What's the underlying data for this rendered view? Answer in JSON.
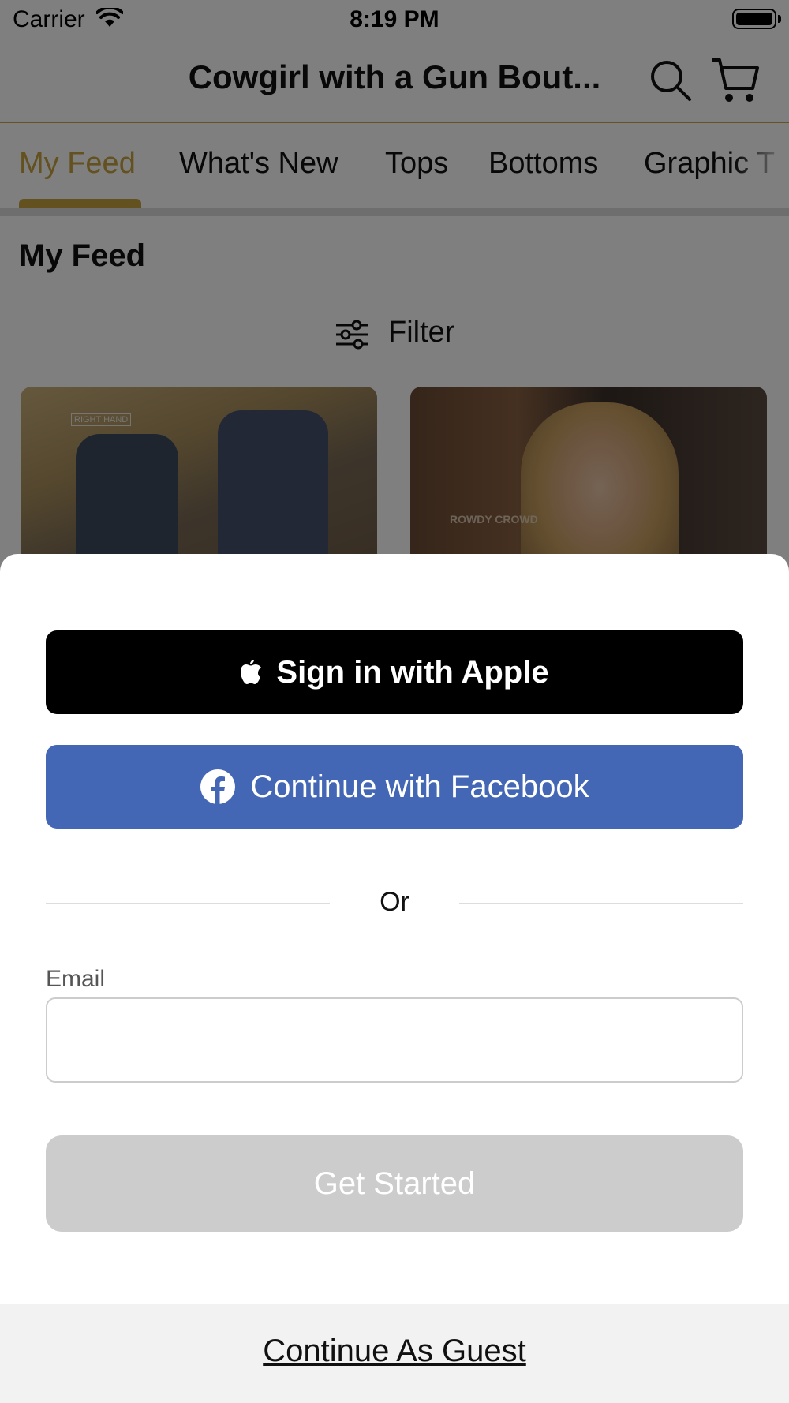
{
  "status_bar": {
    "carrier": "Carrier",
    "time": "8:19 PM"
  },
  "nav": {
    "title": "Cowgirl with a Gun Bout..."
  },
  "tabs": [
    {
      "label": "My Feed",
      "active": true
    },
    {
      "label": "What's New"
    },
    {
      "label": "Tops"
    },
    {
      "label": "Bottoms"
    },
    {
      "label": "Graphic T"
    }
  ],
  "feed": {
    "title": "My Feed",
    "filter_label": "Filter"
  },
  "products": [
    {
      "image_text": "RIGHT HAND"
    },
    {
      "image_text": "ROWDY CROWD"
    }
  ],
  "sheet": {
    "apple_label": "Sign in with Apple",
    "facebook_label": "Continue with Facebook",
    "or_text": "Or",
    "email_label": "Email",
    "email_value": "",
    "get_started_label": "Get Started",
    "guest_label": "Continue As Guest"
  },
  "colors": {
    "accent": "#c9a241",
    "facebook": "#4367b4",
    "apple": "#000000",
    "disabled": "#cccccc"
  }
}
